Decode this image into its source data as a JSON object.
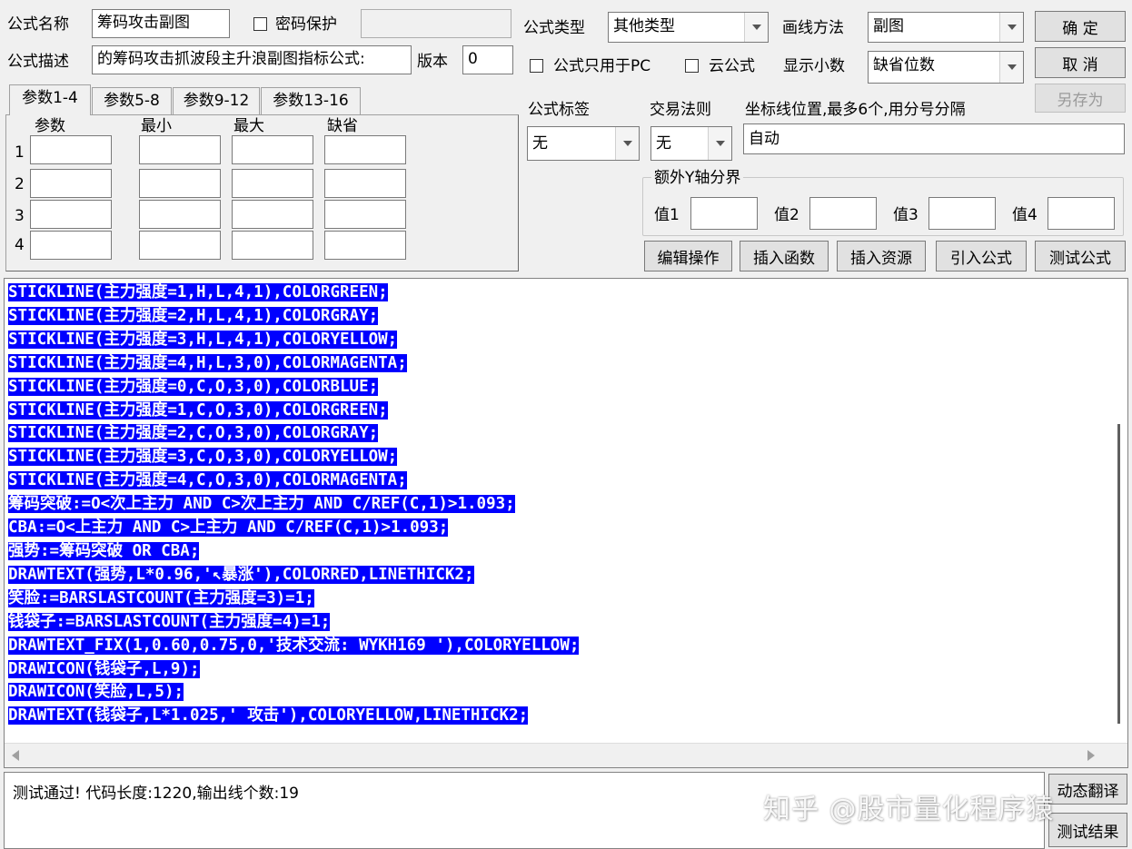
{
  "form": {
    "name_label": "公式名称",
    "name_value": "筹码攻击副图",
    "password_label": "密码保护",
    "desc_label": "公式描述",
    "desc_value": "的筹码攻击抓波段主升浪副图指标公式:",
    "version_label": "版本",
    "version_value": "0",
    "type_label": "公式类型",
    "type_value": "其他类型",
    "draw_label": "画线方法",
    "draw_value": "副图",
    "pc_only_label": "公式只用于PC",
    "cloud_label": "云公式",
    "decimals_label": "显示小数",
    "decimals_value": "缺省位数",
    "tag_label": "公式标签",
    "tag_value": "无",
    "rule_label": "交易法则",
    "rule_value": "无",
    "axis_label": "坐标线位置,最多6个,用分号分隔",
    "axis_value": "自动",
    "extra_y_label": "额外Y轴分界",
    "val1": "值1",
    "val2": "值2",
    "val3": "值3",
    "val4": "值4"
  },
  "buttons": {
    "ok": "确  定",
    "cancel": "取  消",
    "save_as": "另存为",
    "edit": "编辑操作",
    "insert_func": "插入函数",
    "insert_res": "插入资源",
    "import": "引入公式",
    "test": "测试公式",
    "translate": "动态翻译",
    "test_result": "测试结果"
  },
  "tabs": [
    "参数1-4",
    "参数5-8",
    "参数9-12",
    "参数13-16"
  ],
  "params": {
    "headers": [
      "参数",
      "最小",
      "最大",
      "缺省"
    ],
    "rows": [
      "1",
      "2",
      "3",
      "4"
    ]
  },
  "code_lines": [
    "STICKLINE(主力强度=1,H,L,4,1),COLORGREEN;",
    "STICKLINE(主力强度=2,H,L,4,1),COLORGRAY;",
    "STICKLINE(主力强度=3,H,L,4,1),COLORYELLOW;",
    "STICKLINE(主力强度=4,H,L,3,0),COLORMAGENTA;",
    "STICKLINE(主力强度=0,C,O,3,0),COLORBLUE;",
    "STICKLINE(主力强度=1,C,O,3,0),COLORGREEN;",
    "STICKLINE(主力强度=2,C,O,3,0),COLORGRAY;",
    "STICKLINE(主力强度=3,C,O,3,0),COLORYELLOW;",
    "STICKLINE(主力强度=4,C,O,3,0),COLORMAGENTA;",
    "筹码突破:=O<次上主力 AND C>次上主力 AND C/REF(C,1)>1.093;",
    "CBA:=O<上主力 AND C>上主力 AND C/REF(C,1)>1.093;",
    "强势:=筹码突破 OR CBA;",
    "DRAWTEXT(强势,L*0.96,'↖暴涨'),COLORRED,LINETHICK2;",
    "笑脸:=BARSLASTCOUNT(主力强度=3)=1;",
    "钱袋子:=BARSLASTCOUNT(主力强度=4)=1;",
    "DRAWTEXT_FIX(1,0.60,0.75,0,'技术交流: WYKH169 '),COLORYELLOW;",
    "DRAWICON(钱袋子,L,9);",
    "DRAWICON(笑脸,L,5);",
    "DRAWTEXT(钱袋子,L*1.025,' 攻击'),COLORYELLOW,LINETHICK2;"
  ],
  "status_text": "测试通过! 代码长度:1220,输出线个数:19",
  "watermark": "知乎 @股市量化程序猿",
  "colors": {
    "selection": "#0000ff",
    "window_bg": "#f0f0f0"
  }
}
